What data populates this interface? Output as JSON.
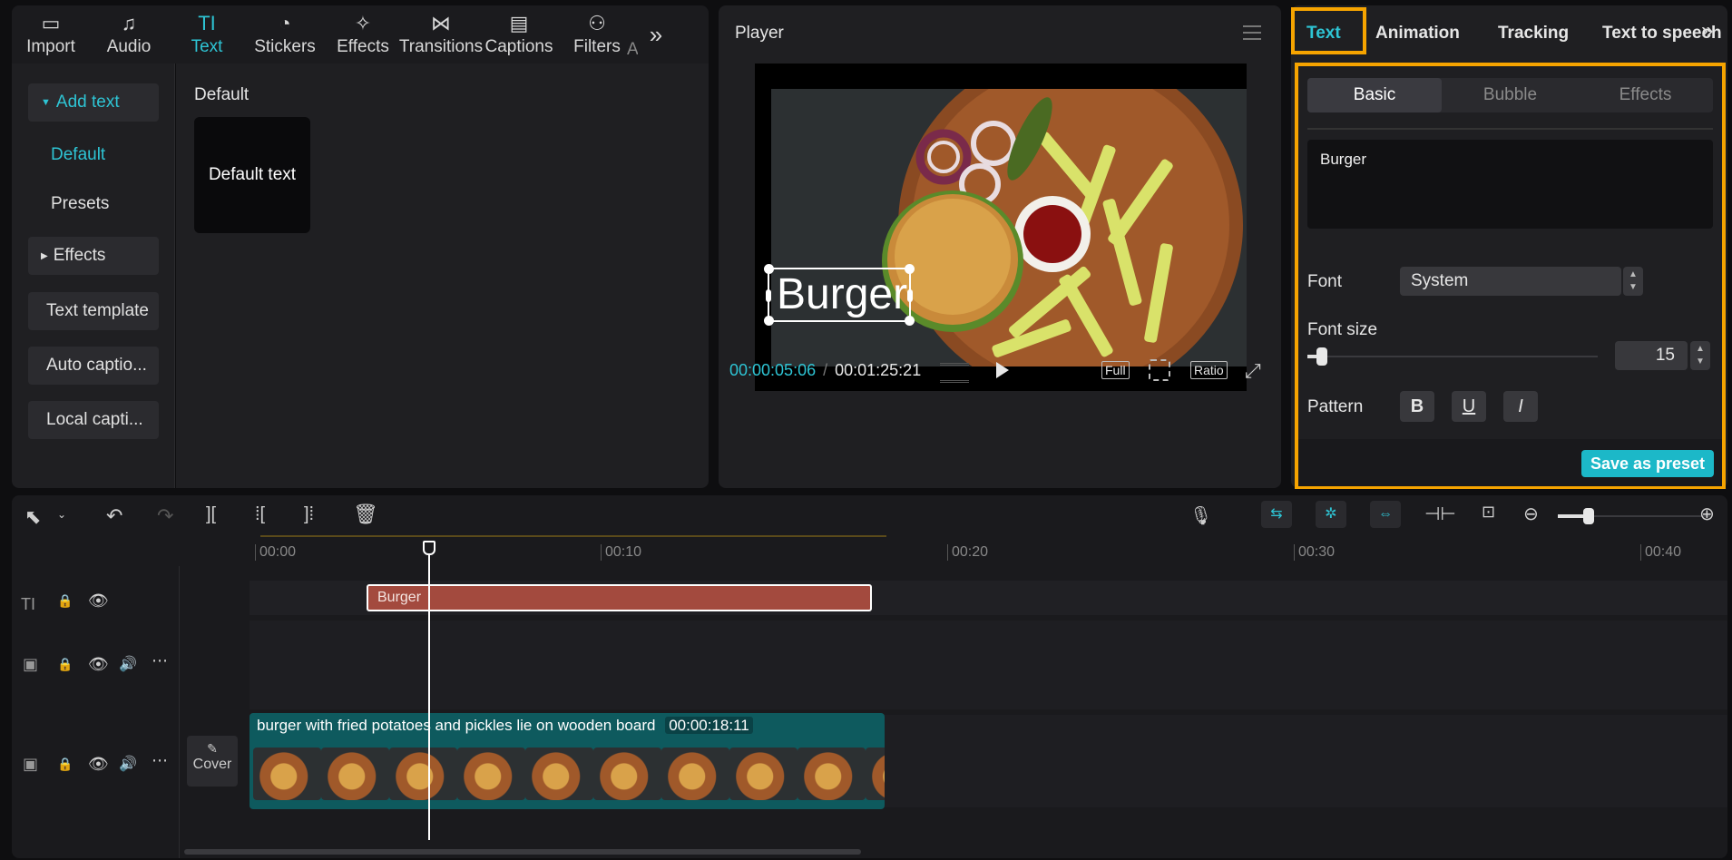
{
  "top_tools": [
    {
      "label": "Import",
      "icon": "import-icon"
    },
    {
      "label": "Audio",
      "icon": "audio-icon"
    },
    {
      "label": "Text",
      "icon": "text-icon",
      "active": true
    },
    {
      "label": "Stickers",
      "icon": "stickers-icon"
    },
    {
      "label": "Effects",
      "icon": "effects-icon"
    },
    {
      "label": "Transitions",
      "icon": "transitions-icon"
    },
    {
      "label": "Captions",
      "icon": "captions-icon"
    },
    {
      "label": "Filters",
      "icon": "filters-icon"
    }
  ],
  "top_tools_overflow": "A",
  "left_nav": {
    "add_text": "Add text",
    "default": "Default",
    "presets": "Presets",
    "effects": "Effects",
    "text_template": "Text template",
    "auto_captions": "Auto captio...",
    "local_captions": "Local capti..."
  },
  "content": {
    "section_title": "Default",
    "card_label": "Default text"
  },
  "player": {
    "title": "Player",
    "overlay_text": "Burger",
    "current_time": "00:00:05:06",
    "separator": "/",
    "total_time": "00:01:25:21",
    "btn_full": "Full",
    "btn_ratio": "Ratio"
  },
  "right_panel": {
    "tabs": [
      "Text",
      "Animation",
      "Tracking",
      "Text to speech"
    ],
    "subtabs": [
      "Basic",
      "Bubble",
      "Effects"
    ],
    "text_value": "Burger",
    "font_label": "Font",
    "font_value": "System",
    "font_size_label": "Font size",
    "font_size_value": "15",
    "font_size_slider": 0.03,
    "pattern_label": "Pattern",
    "bold": "B",
    "underline": "U",
    "italic": "I",
    "save_preset": "Save as preset"
  },
  "timeline": {
    "ticks": [
      "00:00",
      "00:10",
      "00:20",
      "00:30",
      "00:40"
    ],
    "text_clip": "Burger",
    "video_clip_title": "burger with fried potatoes and pickles lie on wooden board",
    "video_clip_duration": "00:00:18:11",
    "cover_label": "Cover",
    "zoom_level": 0.2
  },
  "colors": {
    "accent": "#2ec4d4",
    "highlight": "#f6a400",
    "text_clip": "#a34a3e",
    "video_clip": "#0e5a5e"
  }
}
